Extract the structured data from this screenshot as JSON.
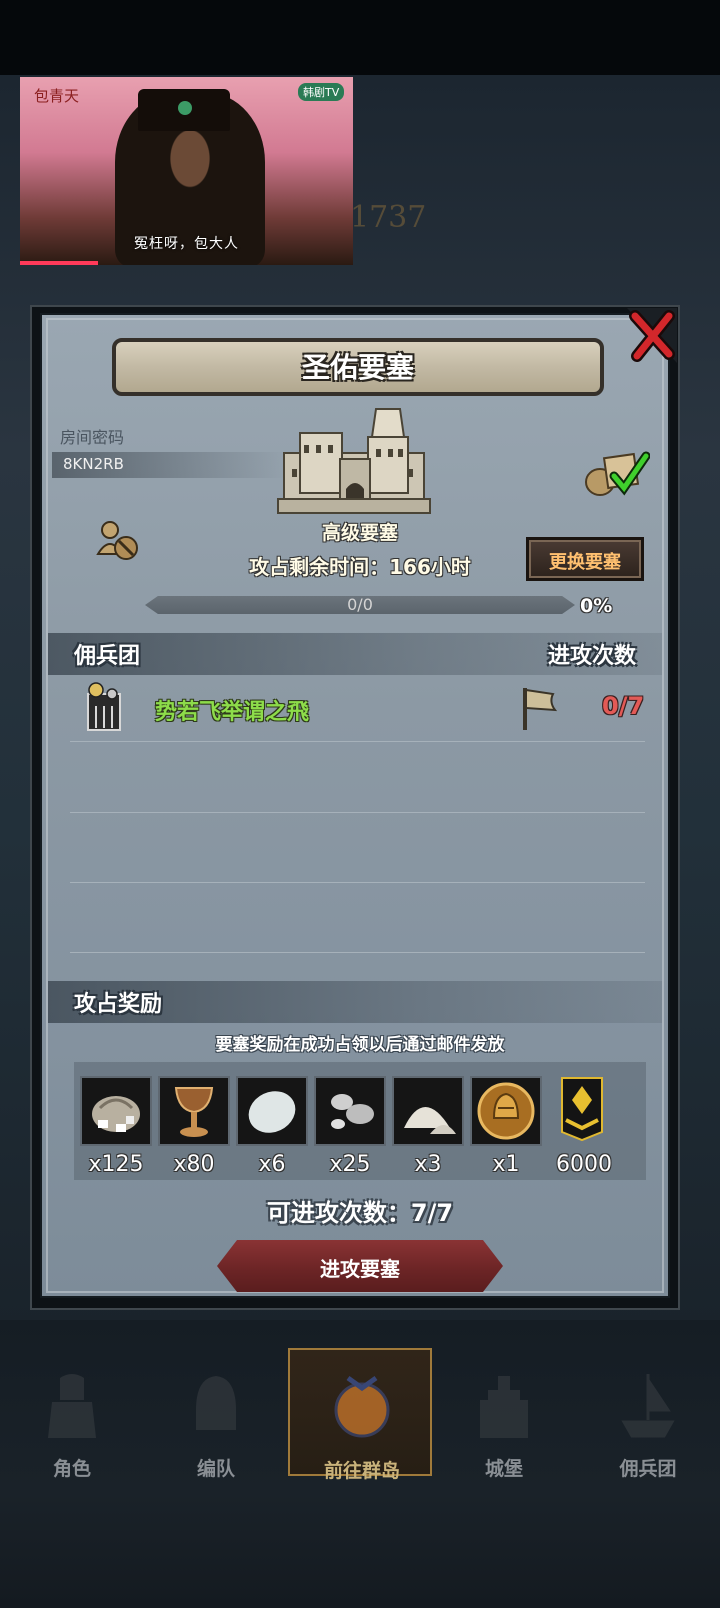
{
  "video": {
    "logo": "包青天",
    "channel": "韩剧TV",
    "caption": "冤枉呀，包大人"
  },
  "background": {
    "score": "1737"
  },
  "dialog": {
    "title": "圣佑要塞",
    "room_label": "房间密码",
    "room_code": "8KN2RB",
    "fortress_grade": "高级要塞",
    "time_remaining": "攻占剩余时间：166小时",
    "change_button": "更换要塞",
    "progress_text": "0/0",
    "progress_percent": "0%",
    "progress_value": 0,
    "mercenary_header": "佣兵团",
    "attacks_header": "进攻次数",
    "guild": {
      "name": "势若飞举谓之飛",
      "attack_count": "0/7"
    },
    "reward_header": "攻占奖励",
    "reward_note": "要塞奖励在成功占领以后通过邮件发放",
    "rewards": [
      {
        "icon": "sack-of-coins-icon",
        "qty": "x125"
      },
      {
        "icon": "goblet-icon",
        "qty": "x80"
      },
      {
        "icon": "white-stone-icon",
        "qty": "x6"
      },
      {
        "icon": "silver-beads-icon",
        "qty": "x25"
      },
      {
        "icon": "salt-pile-icon",
        "qty": "x3"
      },
      {
        "icon": "gold-helmet-medal-icon",
        "qty": "x1"
      },
      {
        "icon": "rank-badge-icon",
        "qty": "6000"
      }
    ],
    "available_attacks": "可进攻次数：7/7",
    "attack_button": "进攻要塞"
  },
  "nav": {
    "items": [
      {
        "label": "角色",
        "icon": "knight-icon"
      },
      {
        "label": "编队",
        "icon": "helmet-icon"
      },
      {
        "label": "前往群岛",
        "icon": "island-icon"
      },
      {
        "label": "城堡",
        "icon": "castle-icon"
      },
      {
        "label": "佣兵团",
        "icon": "ship-icon"
      }
    ]
  },
  "colors": {
    "guild_name": "#8ddc4a",
    "attack_count": "#e25a56",
    "change_button_text": "#ffc070",
    "attack_button": "#7a2c2d"
  }
}
